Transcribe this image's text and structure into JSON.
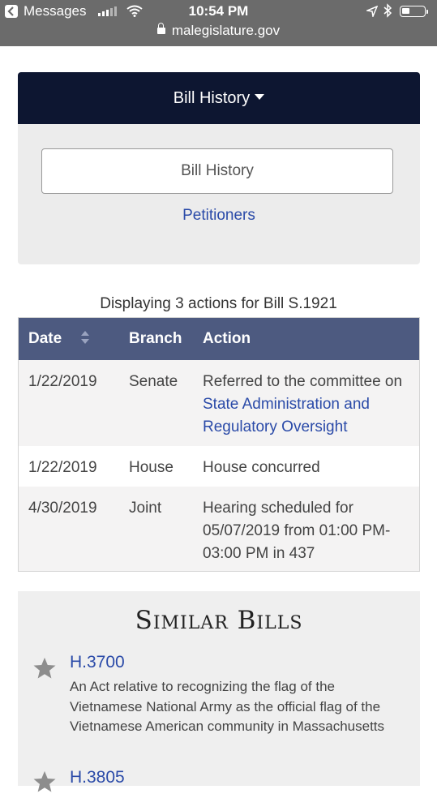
{
  "status_bar": {
    "back_app": "Messages",
    "time": "10:54 PM",
    "url": "malegislature.gov",
    "battery_level": 0.35
  },
  "bill_history_menu": {
    "header_label": "Bill History",
    "selected_option": "Bill History",
    "other_option": "Petitioners"
  },
  "actions_summary": "Displaying 3 actions for Bill S.1921",
  "table": {
    "headers": {
      "date": "Date",
      "branch": "Branch",
      "action": "Action"
    },
    "rows": [
      {
        "date": "1/22/2019",
        "branch": "Senate",
        "action_prefix": "Referred to the committee on ",
        "action_link": "State Administration and Regulatory Oversight"
      },
      {
        "date": "1/22/2019",
        "branch": "House",
        "action": "House concurred"
      },
      {
        "date": "4/30/2019",
        "branch": "Joint",
        "action": "Hearing scheduled for 05/07/2019 from 01:00 PM-03:00 PM in 437"
      }
    ]
  },
  "similar_bills": {
    "title": "Similar Bills",
    "items": [
      {
        "number": "H.3700",
        "description": "An Act relative to recognizing the flag of the Vietnamese National Army as the official flag of the Vietnamese American community in Massachusetts"
      },
      {
        "number": "H.3805"
      }
    ]
  },
  "colors": {
    "status_bar_bg": "#6b6b6b",
    "menu_header_bg": "#0d1631",
    "table_header_bg": "#4d5a80",
    "link": "#2a4aa8"
  }
}
